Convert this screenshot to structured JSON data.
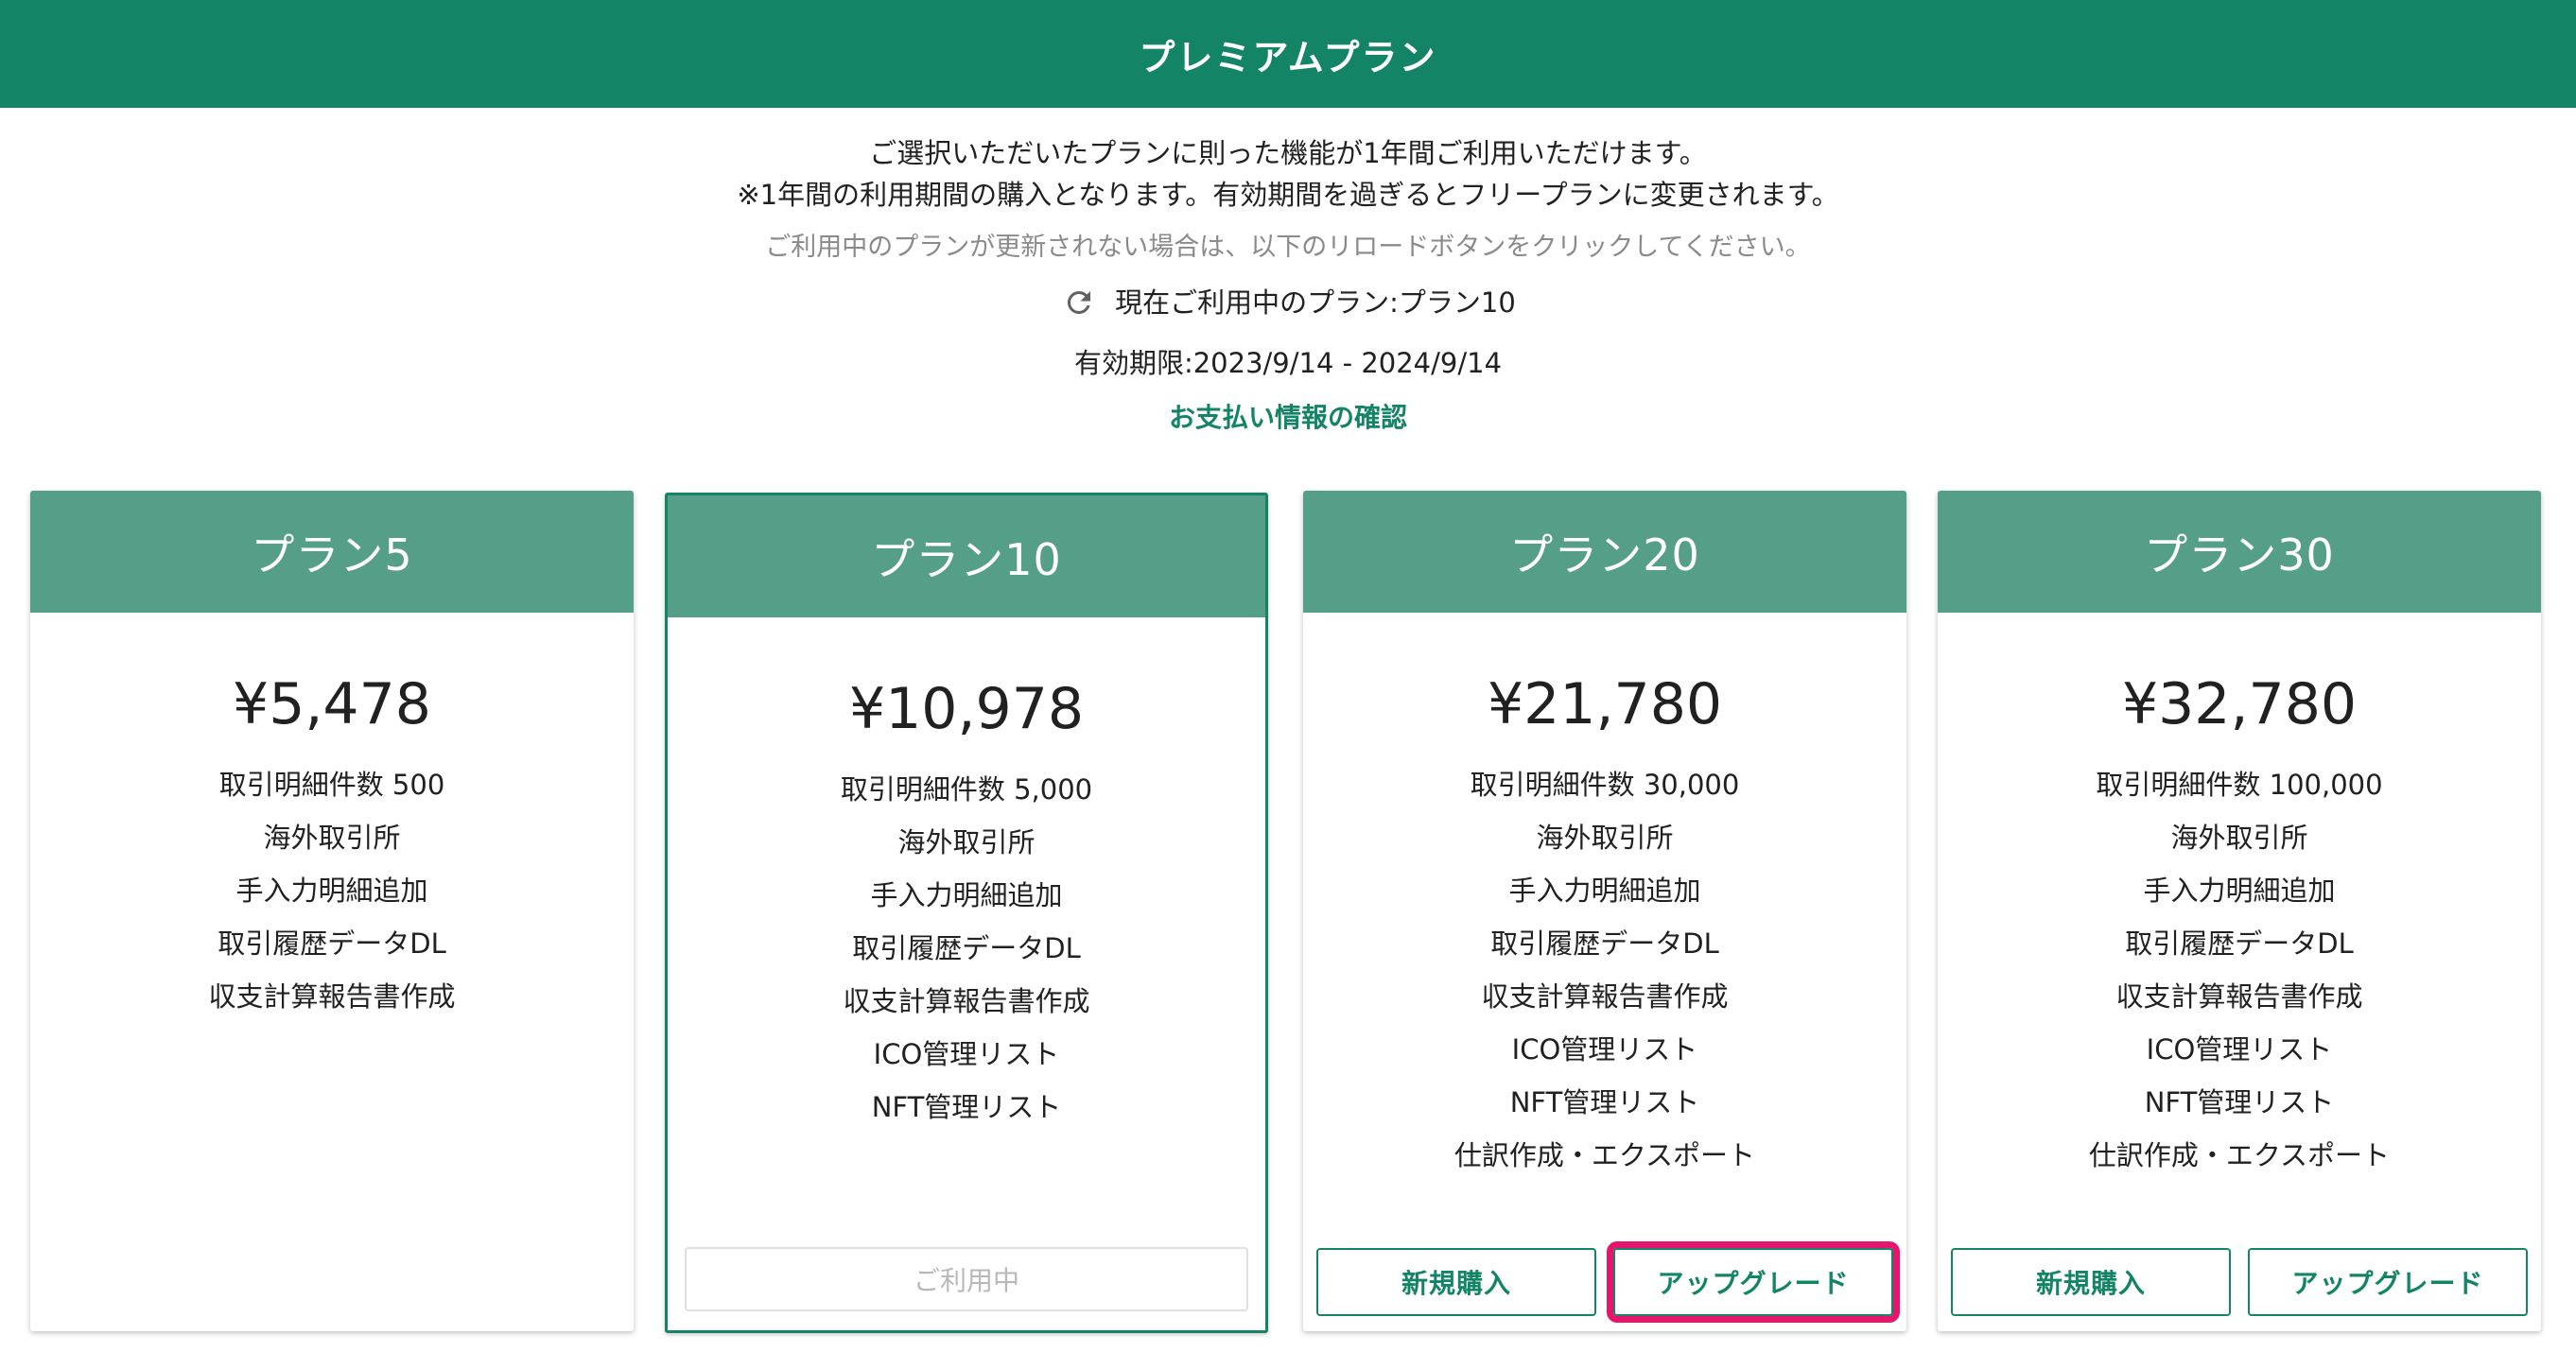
{
  "header": {
    "title": "プレミアムプラン"
  },
  "intro": {
    "line1": "ご選択いただいたプランに則った機能が1年間ご利用いただけます。",
    "line2": "※1年間の利用期間の購入となります。有効期間を過ぎるとフリープランに変更されます。",
    "note": "ご利用中のプランが更新されない場合は、以下のリロードボタンをクリックしてください。",
    "current_plan": "現在ご利用中のプラン:プラン10",
    "validity": "有効期限:2023/9/14 - 2024/9/14",
    "payment_link": "お支払い情報の確認"
  },
  "plans": [
    {
      "name": "プラン5",
      "price": "¥5,478",
      "features": [
        "取引明細件数 500",
        "海外取引所",
        "手入力明細追加",
        "取引履歴データDL",
        "収支計算報告書作成"
      ]
    },
    {
      "name": "プラン10",
      "price": "¥10,978",
      "features": [
        "取引明細件数 5,000",
        "海外取引所",
        "手入力明細追加",
        "取引履歴データDL",
        "収支計算報告書作成",
        "ICO管理リスト",
        "NFT管理リスト"
      ],
      "current_label": "ご利用中"
    },
    {
      "name": "プラン20",
      "price": "¥21,780",
      "features": [
        "取引明細件数 30,000",
        "海外取引所",
        "手入力明細追加",
        "取引履歴データDL",
        "収支計算報告書作成",
        "ICO管理リスト",
        "NFT管理リスト",
        "仕訳作成・エクスポート"
      ],
      "buy_label": "新規購入",
      "upgrade_label": "アップグレード"
    },
    {
      "name": "プラン30",
      "price": "¥32,780",
      "features": [
        "取引明細件数 100,000",
        "海外取引所",
        "手入力明細追加",
        "取引履歴データDL",
        "収支計算報告書作成",
        "ICO管理リスト",
        "NFT管理リスト",
        "仕訳作成・エクスポート"
      ],
      "buy_label": "新規購入",
      "upgrade_label": "アップグレード"
    }
  ],
  "colors": {
    "header": "#138466",
    "card_header": "#559e88",
    "accent": "#138466",
    "highlight": "#e8156d"
  },
  "icons": {
    "reload": "reload-icon"
  }
}
